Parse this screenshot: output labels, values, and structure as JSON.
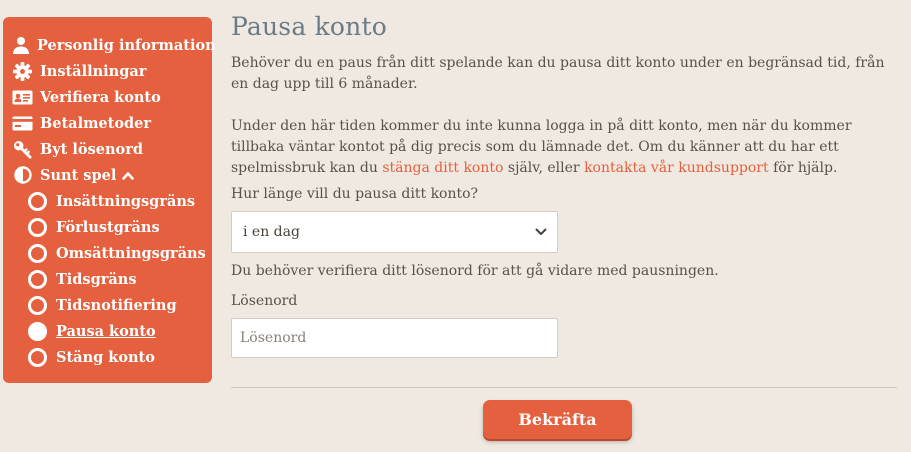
{
  "sidebar": {
    "items": [
      {
        "label": "Personlig information",
        "icon": "user-icon"
      },
      {
        "label": "Inställningar",
        "icon": "gear-icon"
      },
      {
        "label": "Verifiera konto",
        "icon": "id-card-icon"
      },
      {
        "label": "Betalmetoder",
        "icon": "credit-card-icon"
      },
      {
        "label": "Byt lösenord",
        "icon": "key-icon"
      },
      {
        "label": "Sunt spel",
        "icon": "half-circle-icon",
        "expanded": true
      }
    ],
    "subitems": [
      {
        "label": "Insättningsgräns"
      },
      {
        "label": "Förlustgräns"
      },
      {
        "label": "Omsättningsgräns"
      },
      {
        "label": "Tidsgräns"
      },
      {
        "label": "Tidsnotifiering"
      },
      {
        "label": "Pausa konto",
        "active": true
      },
      {
        "label": "Stäng konto"
      }
    ]
  },
  "main": {
    "title": "Pausa konto",
    "intro": "Behöver du en paus från ditt spelande kan du pausa ditt konto under en begränsad tid, från en dag upp till 6 månader.",
    "info_before": "Under den här tiden kommer du inte kunna logga in på ditt konto, men när du kommer tillbaka väntar kontot på dig precis som du lämnade det. Om du känner att du har ett spelmissbruk kan du ",
    "link_close": "stänga ditt konto",
    "info_middle": " själv, eller ",
    "link_support": "kontakta vår kundsupport",
    "info_after": " för hjälp.",
    "duration_label": "Hur länge vill du pausa ditt konto?",
    "duration_value": "i en dag",
    "verify_text": "Du behöver verifiera ditt lösenord för att gå vidare med pausningen.",
    "password_label": "Lösenord",
    "password_placeholder": "Lösenord",
    "confirm_label": "Bekräfta"
  },
  "colors": {
    "accent": "#e5603e",
    "background": "#efe9e1",
    "title": "#6b7c87"
  }
}
